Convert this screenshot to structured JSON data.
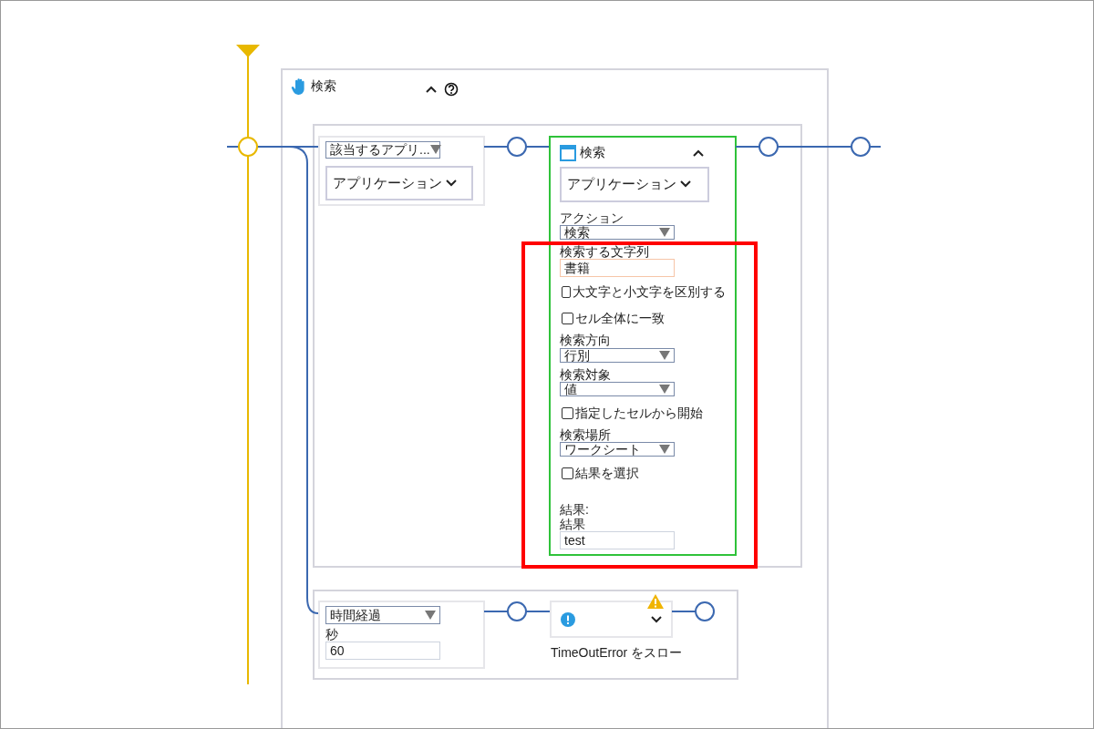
{
  "block": {
    "title": "検索",
    "expanded": true
  },
  "condition": {
    "select": "該当するアプリ...",
    "app_button": "アプリケーション"
  },
  "action": {
    "title": "検索",
    "expanded": true,
    "app_button": "アプリケーション",
    "fields": [
      {
        "kind": "select",
        "label": "アクション",
        "value": "検索"
      },
      {
        "kind": "text",
        "label": "検索する文字列",
        "value": "書籍"
      },
      {
        "kind": "checkbox",
        "label": "大文字と小文字を区別する",
        "checked": false
      },
      {
        "kind": "checkbox",
        "label": "セル全体に一致",
        "checked": false
      },
      {
        "kind": "select",
        "label": "検索方向",
        "value": "行別"
      },
      {
        "kind": "select",
        "label": "検索対象",
        "value": "値"
      },
      {
        "kind": "checkbox",
        "label": "指定したセルから開始",
        "checked": false
      },
      {
        "kind": "select",
        "label": "検索場所",
        "value": "ワークシート"
      },
      {
        "kind": "checkbox",
        "label": "結果を選択",
        "checked": false
      },
      {
        "kind": "output",
        "heading": "結果:",
        "label": "結果",
        "value": "test"
      }
    ]
  },
  "timeout": {
    "select": "時間経過",
    "label": "秒",
    "value": "60",
    "error_label": "TimeOutError をスロー",
    "expanded": false
  }
}
